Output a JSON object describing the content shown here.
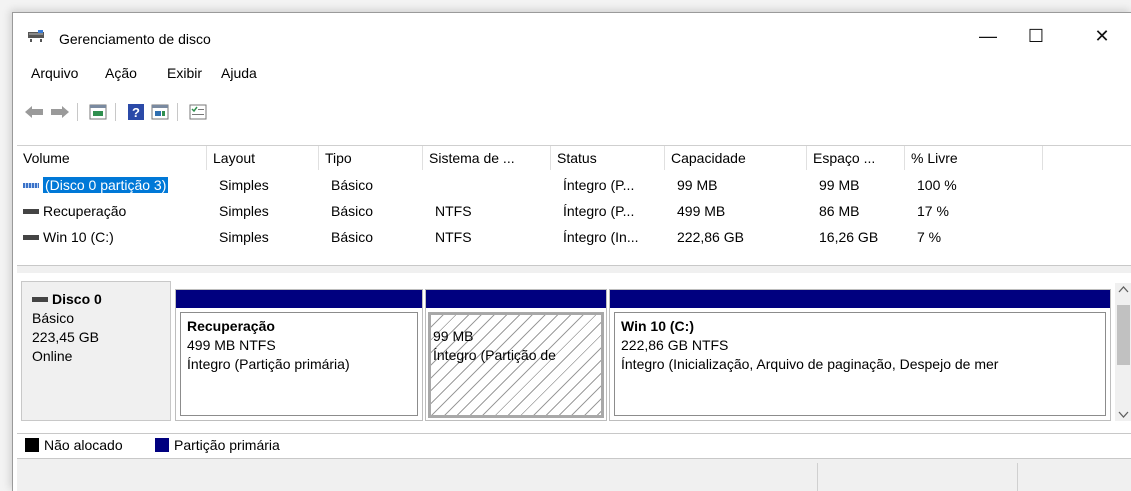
{
  "window": {
    "title": "Gerenciamento de disco",
    "minimize": "—",
    "maximize": "☐",
    "close": "✕"
  },
  "menu": [
    "Arquivo",
    "Ação",
    "Exibir",
    "Ajuda"
  ],
  "toolbar": {
    "icons": [
      "back-arrow-icon",
      "forward-arrow-icon",
      "disk-view-icon",
      "help-icon",
      "disk-list-icon",
      "properties-icon"
    ]
  },
  "volumes": {
    "columns": [
      "Volume",
      "Layout",
      "Tipo",
      "Sistema de ...",
      "Status",
      "Capacidade",
      "Espaço ...",
      "% Livre"
    ],
    "rows": [
      [
        "(Disco 0 partição 3)",
        "Simples",
        "Básico",
        "",
        "Íntegro (P...",
        "99 MB",
        "99 MB",
        "100 %"
      ],
      [
        "Recuperação",
        "Simples",
        "Básico",
        "NTFS",
        "Íntegro (P...",
        "499 MB",
        "86 MB",
        "17 %"
      ],
      [
        "Win 10 (C:)",
        "Simples",
        "Básico",
        "NTFS",
        "Íntegro (In...",
        "222,86 GB",
        "16,26 GB",
        "7 %"
      ]
    ],
    "selected_row": 0
  },
  "disk": {
    "name": "Disco 0",
    "type": "Básico",
    "size": "223,45 GB",
    "state": "Online",
    "partitions": [
      {
        "name": "Recuperação",
        "size": "499 MB NTFS",
        "status": "Íntegro (Partição primária)"
      },
      {
        "name": "",
        "size": "99 MB",
        "status": "Íntegro (Partição de"
      },
      {
        "name": "Win 10  (C:)",
        "size": "222,86 GB NTFS",
        "status": "Íntegro (Inicialização, Arquivo de paginação, Despejo de mer"
      }
    ]
  },
  "legend": {
    "unallocated": "Não alocado",
    "primary": "Partição primária",
    "unallocated_color": "#000000",
    "primary_color": "#00007f"
  },
  "colors": {
    "accent": "#0078d7",
    "partition_bar": "#00007f"
  }
}
